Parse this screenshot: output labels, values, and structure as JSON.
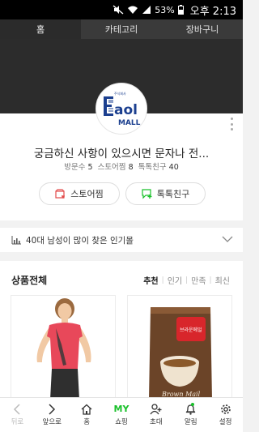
{
  "status": {
    "battery": "53%",
    "time": "오후 2:13"
  },
  "tabs": [
    {
      "label": "홈"
    },
    {
      "label": "카테고리"
    },
    {
      "label": "장바구니"
    }
  ],
  "store": {
    "logo_top": "주식회사",
    "logo_mark": "aol",
    "logo_sub": "MALL",
    "title": "궁금하신 사항이 있으시면 문자나 전...",
    "stats": {
      "visits_label": "방문수",
      "visits": "5",
      "store_fav_label": "스토어찜",
      "store_fav": "8",
      "talk_friends_label": "톡톡친구",
      "talk_friends": "40"
    },
    "buttons": {
      "store_fav": "스토어찜",
      "talk_friend": "톡톡친구"
    }
  },
  "popular": {
    "label": "40대 남성이 많이 찾은 인기몰"
  },
  "products": {
    "title": "상품전체",
    "sorts": [
      "추천",
      "인기",
      "만족",
      "최신"
    ],
    "items": [
      {
        "kind": "apparel"
      },
      {
        "kind": "coffee",
        "packet_text": "Brown Mail",
        "label_text": "브라운메일"
      }
    ]
  },
  "bottomnav": [
    {
      "label": "뒤로",
      "icon": "back-icon"
    },
    {
      "label": "앞으로",
      "icon": "forward-icon"
    },
    {
      "label": "홈",
      "icon": "home-icon"
    },
    {
      "label": "쇼핑",
      "icon": "my-shopping-icon",
      "badge": "MY"
    },
    {
      "label": "초대",
      "icon": "invite-icon"
    },
    {
      "label": "알림",
      "icon": "bell-icon"
    },
    {
      "label": "설정",
      "icon": "gear-icon"
    }
  ],
  "colors": {
    "accent": "#19c12a",
    "cover": "#2c2c2c",
    "tabs": "#3a3a3a"
  }
}
